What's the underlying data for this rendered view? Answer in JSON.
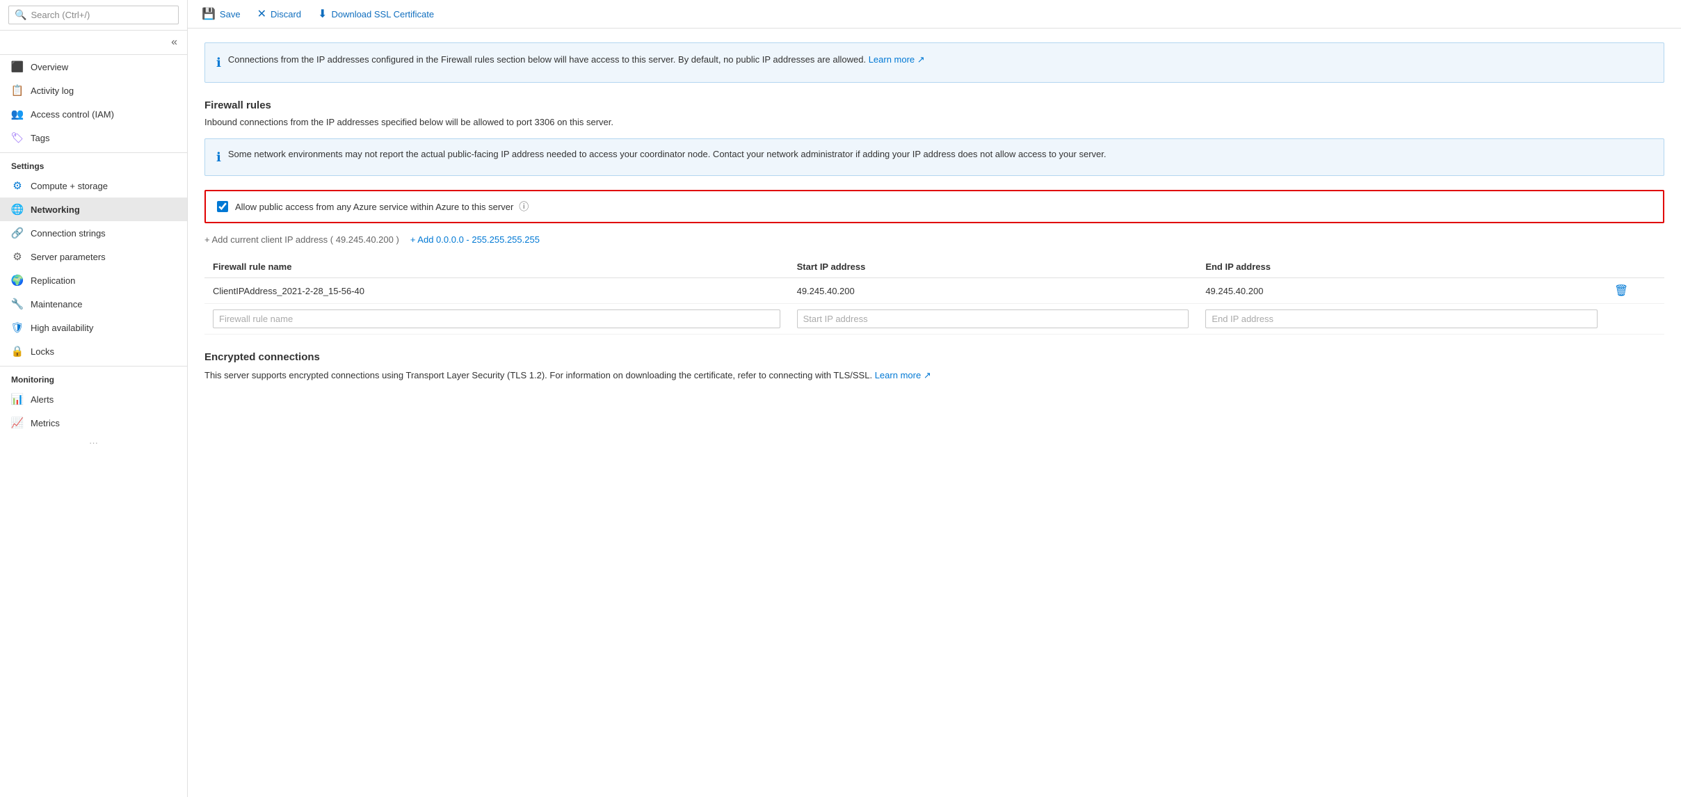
{
  "sidebar": {
    "search_placeholder": "Search (Ctrl+/)",
    "collapse_icon": "«",
    "items_top": [
      {
        "id": "overview",
        "label": "Overview",
        "icon": "overview"
      },
      {
        "id": "activity-log",
        "label": "Activity log",
        "icon": "activity"
      },
      {
        "id": "access-control",
        "label": "Access control (IAM)",
        "icon": "people"
      },
      {
        "id": "tags",
        "label": "Tags",
        "icon": "tag"
      }
    ],
    "sections": [
      {
        "label": "Settings",
        "items": [
          {
            "id": "compute-storage",
            "label": "Compute + storage",
            "icon": "gear"
          },
          {
            "id": "networking",
            "label": "Networking",
            "icon": "net",
            "active": true
          },
          {
            "id": "connection-strings",
            "label": "Connection strings",
            "icon": "link"
          },
          {
            "id": "server-parameters",
            "label": "Server parameters",
            "icon": "params"
          },
          {
            "id": "replication",
            "label": "Replication",
            "icon": "globe"
          },
          {
            "id": "maintenance",
            "label": "Maintenance",
            "icon": "wrench"
          },
          {
            "id": "high-availability",
            "label": "High availability",
            "icon": "shield"
          },
          {
            "id": "locks",
            "label": "Locks",
            "icon": "lock"
          }
        ]
      },
      {
        "label": "Monitoring",
        "items": [
          {
            "id": "alerts",
            "label": "Alerts",
            "icon": "alert"
          },
          {
            "id": "metrics",
            "label": "Metrics",
            "icon": "chart"
          }
        ]
      }
    ]
  },
  "toolbar": {
    "save_label": "Save",
    "discard_label": "Discard",
    "download_ssl_label": "Download SSL Certificate"
  },
  "info_banner": {
    "text": "Connections from the IP addresses configured in the Firewall rules section below will have access to this server. By default, no public IP addresses are allowed.",
    "learn_more_label": "Learn more",
    "learn_more_icon": "↗"
  },
  "firewall_section": {
    "title": "Firewall rules",
    "description": "Inbound connections from the IP addresses specified below will be allowed to port 3306 on this server.",
    "net_banner": "Some network environments may not report the actual public-facing IP address needed to access your coordinator node. Contact your network administrator if adding your IP address does not allow access to your server.",
    "allow_azure_label": "Allow public access from any Azure service within Azure to this server",
    "add_client_ip_label": "+ Add current client IP address ( 49.245.40.200 )",
    "add_range_label": "+ Add 0.0.0.0 - 255.255.255.255",
    "table": {
      "headers": [
        "Firewall rule name",
        "Start IP address",
        "End IP address"
      ],
      "rows": [
        {
          "rule_name": "ClientIPAddress_2021-2-28_15-56-40",
          "start_ip": "49.245.40.200",
          "end_ip": "49.245.40.200"
        }
      ],
      "new_row_placeholders": {
        "rule_name": "Firewall rule name",
        "start_ip": "Start IP address",
        "end_ip": "End IP address"
      }
    }
  },
  "encrypted_section": {
    "title": "Encrypted connections",
    "description": "This server supports encrypted connections using Transport Layer Security (TLS 1.2). For information on downloading the certificate, refer to connecting with TLS/SSL.",
    "learn_more_label": "Learn more",
    "learn_more_icon": "↗"
  }
}
